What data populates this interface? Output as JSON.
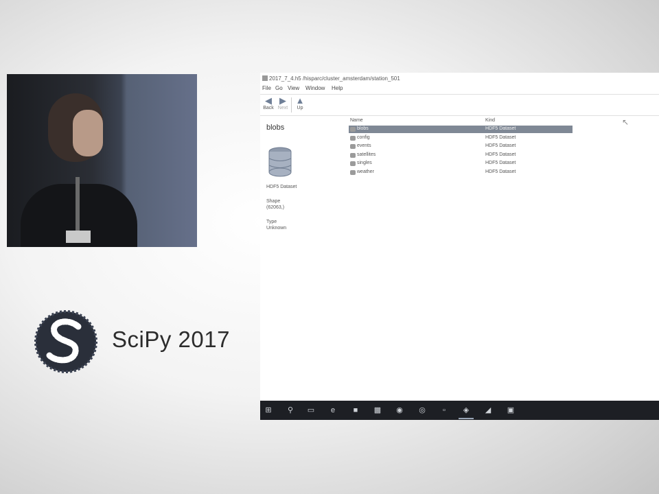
{
  "logo": {
    "text": "SciPy 2017"
  },
  "window": {
    "title": "2017_7_4.h5 /hisparc/cluster_amsterdam/station_501",
    "menu": [
      "File",
      "Go",
      "View",
      "Window",
      "Help"
    ],
    "toolbar": {
      "back": "Back",
      "next": "Next",
      "up": "Up"
    }
  },
  "details": {
    "title": "blobs",
    "kind": "HDF5 Dataset",
    "shape_label": "Shape",
    "shape_value": "(62063,)",
    "type_label": "Type",
    "type_value": "Unknown"
  },
  "list": {
    "col_name": "Name",
    "col_kind": "Kind",
    "rows": [
      {
        "name": "blobs",
        "kind": "HDF5 Dataset",
        "selected": true
      },
      {
        "name": "config",
        "kind": "HDF5 Dataset"
      },
      {
        "name": "events",
        "kind": "HDF5 Dataset"
      },
      {
        "name": "satellites",
        "kind": "HDF5 Dataset"
      },
      {
        "name": "singles",
        "kind": "HDF5 Dataset"
      },
      {
        "name": "weather",
        "kind": "HDF5 Dataset"
      }
    ]
  },
  "taskbar": {
    "icons": [
      "windows-start-icon",
      "search-icon",
      "task-view-icon",
      "edge-browser-icon",
      "file-explorer-icon",
      "photos-icon",
      "firefox-icon",
      "chrome-icon",
      "app-icon",
      "viewer-app-icon",
      "store-icon",
      "powerpoint-icon"
    ]
  },
  "colors": {
    "selection": "#7f8895",
    "taskbar": "#1d1f24"
  }
}
